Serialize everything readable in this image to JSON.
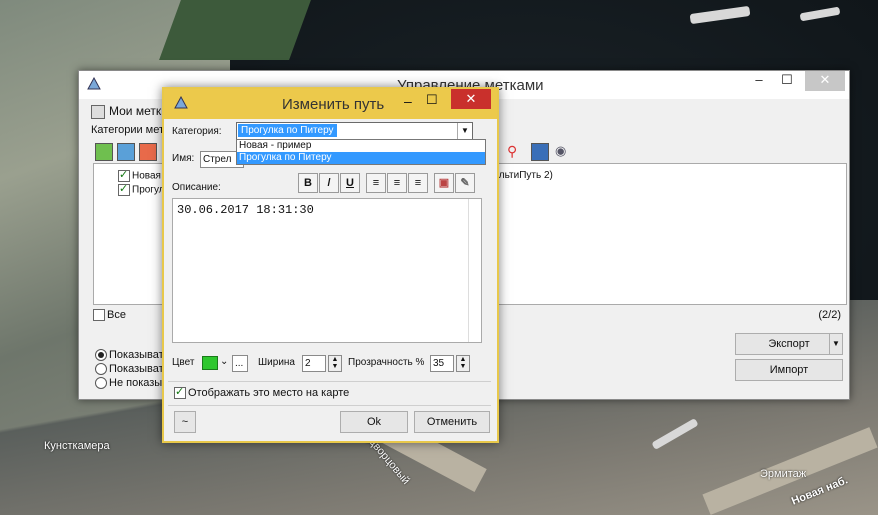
{
  "map": {
    "labels": [
      "Кунсткамера",
      "Дворцовый",
      "Эрмитаж",
      "Новая наб."
    ]
  },
  "main_window": {
    "title": "Управление метками",
    "section_title": "Мои метки",
    "categories_label": "Категории мет",
    "list_rows": [
      "Новая -",
      "Прогулк"
    ],
    "list_right_text": "ультиПуть 2)",
    "all_label": "Все",
    "count": "(2/2)",
    "radio_options": [
      "Показывать",
      "Показывать",
      "Не показыв"
    ],
    "export_label": "Экспорт",
    "import_label": "Импорт",
    "min": "–",
    "max": "☐",
    "close": "✕"
  },
  "dialog": {
    "title": "Изменить путь",
    "category_label": "Категория:",
    "category_value": "Прогулка по Питеру",
    "dropdown_options": [
      "Новая - пример",
      "Прогулка по Питеру"
    ],
    "name_label": "Имя:",
    "name_value": "Стрел",
    "description_label": "Описание:",
    "format_buttons": [
      "B",
      "/",
      "U"
    ],
    "description_text": "30.06.2017 18:31:30",
    "color_label": "Цвет",
    "color_value": "#2ec72e",
    "dots": "...",
    "width_label": "Ширина",
    "width_value": "2",
    "opacity_label": "Прозрачность %",
    "opacity_value": "35",
    "show_on_map_label": "Отображать это место на карте",
    "ok_label": "Ok",
    "cancel_label": "Отменить",
    "tilde": "~",
    "min": "–",
    "max": "☐",
    "close": "✕"
  }
}
